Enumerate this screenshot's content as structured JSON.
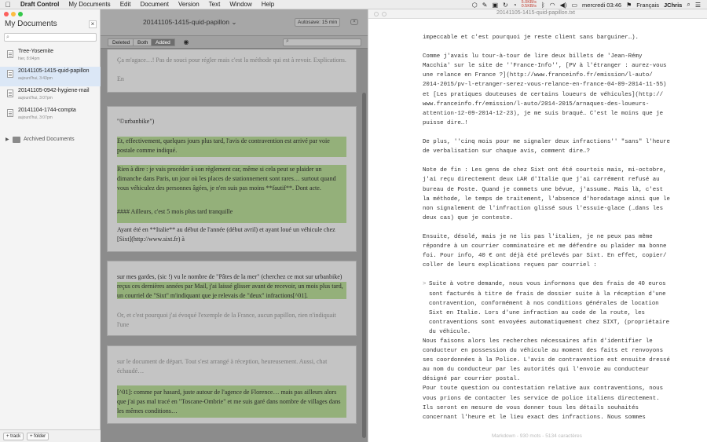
{
  "menubar": {
    "app_name": "Draft Control",
    "items": [
      "My Documents",
      "Edit",
      "Document",
      "Version",
      "Text",
      "Window",
      "Help"
    ],
    "speed_up": "5.0KB/s",
    "speed_down": "0.5KB/s",
    "clock": "mercredi 03:46",
    "language": "Français",
    "user": "JChris"
  },
  "sidebar": {
    "title": "My Documents",
    "close_label": "×",
    "documents": [
      {
        "name": "Tree-Yosemite",
        "date": "hier, 8:04pm"
      },
      {
        "name": "20141105-1415-quid-papillon",
        "date": "aujourd'hui, 3:43pm"
      },
      {
        "name": "20141105-0942-hygiene-mail",
        "date": "aujourd'hui, 3:07pm"
      },
      {
        "name": "20141104-1744-compta",
        "date": "aujourd'hui, 3:07pm"
      }
    ],
    "archived_label": "Archived Documents",
    "add_track_label": "+ track",
    "add_folder_label": "+ folder"
  },
  "document_pane": {
    "title": "20141105-1415-quid-papillon ⌄",
    "autosave": "Autosave: 15 min",
    "filters": {
      "deleted": "Deleted",
      "both": "Both",
      "added": "Added"
    },
    "cards": [
      {
        "lines": [
          "Ça m'agace…! Pas de souci pour régler mais c'est la méthode qui est à revoir. Explications.",
          "En"
        ]
      },
      {
        "quote": "\"©urbanbike\")",
        "p1": "Et, effectivement, quelques jours plus tard, l'avis de contravention est arrivé par voie postale comme indiqué.",
        "p2": "Rien à dire : je vais procéder à son règlement car, même si cela peut se plaider un dimanche dans Paris, un jour où les places de stationnement sont rares… surtout quand vous véhiculez des personnes âgées, je n'en suis pas moins **fautif**. Dont acte.",
        "heading": "#### Ailleurs, c'est 5 mois plus tard tranquille",
        "p3": "Ayant été en **Italie** au début de l'année (début avril) et ayant loué un véhicule chez [Sixt](http://www.sixt.fr) à"
      },
      {
        "p1": "sur mes gardes, (sic !) vu le nombre de \"Pâtes de la mer\" (cherchez ce mot sur urbanbike) reçus ces dernières années par Mail, j'ai laissé glisser avant de recevoir, un mois plus tard, un courriel de \"Sixt\" m'indiquant que je relevais de \"deux\" infractions[^01].",
        "p2": "Or, et c'est pourquoi j'ai évoqué l'exemple de la France, aucun papillon, rien n'indiquait l'une"
      },
      {
        "p1": "sur le document de départ. Tout s'est arrangé à réception, heureusement. Aussi, chat échaudé…",
        "p2": "[^01]: comme par hasard, juste autour de l'agence de Florence… mais pas ailleurs alors que j'ai pas mal tracé en \"Toscane-Ombrie\" et me suis garé dans nombre de villages dans les mêmes conditions…"
      }
    ]
  },
  "editor": {
    "title": "20141105-1415-quid-papillon.txt",
    "footer": "Markdown - 930 mots - 5134 caractères",
    "lines": [
      {
        "t": "impeccable et c'est pourquoi je reste client sans barguiner…)."
      },
      {
        "gap": true
      },
      {
        "t": "Comme j'avais lu tour-à-tour de lire deux billets de 'Jean-Rémy"
      },
      {
        "t": "Macchia' sur le site de ''France-Info'', [PV à l'étranger : aurez-vous"
      },
      {
        "t": "une relance en France ?](http://www.franceinfo.fr/emission/l-auto/"
      },
      {
        "t": "2014-2015/pv-l-etranger-serez-vous-relance-en-france-04-09-2014-11-55)"
      },
      {
        "t": "et [Les pratiques douteuses de certains loueurs de véhicules](http://"
      },
      {
        "t": "www.franceinfo.fr/emission/l-auto/2014-2015/arnaques-des-loueurs-"
      },
      {
        "t": "attention-12-09-2014-12-23), je me suis braqué… C'est le moins que je"
      },
      {
        "t": "puisse dire…!"
      },
      {
        "gap": true
      },
      {
        "t": "De plus, ''cinq mois pour me signaler deux infractions'' \"sans\" l'heure"
      },
      {
        "t": "de verbalisation sur chaque avis, comment dire…?"
      },
      {
        "gap": true
      },
      {
        "t": "Note de fin : Les gens de chez Sixt ont été courtois mais, mi-octobre,"
      },
      {
        "t": "j'ai reçu directement deux LAR d'Italie que j'ai carrément refusé au"
      },
      {
        "t": "bureau de Poste. Quand je commets une bévue, j'assume. Mais là, c'est"
      },
      {
        "t": "la méthode, le temps de traitement, l'absence d'horodatage ainsi que le"
      },
      {
        "t": "non signalement de l'infraction glissé sous l'essuie-glace (…dans les"
      },
      {
        "t": "deux cas) que je conteste."
      },
      {
        "gap": true
      },
      {
        "t": "Ensuite, désolé, mais je ne lis pas l'italien, je ne peux pas même"
      },
      {
        "t": "répondre à un courrier comminatoire et me défendre ou plaider ma bonne"
      },
      {
        "t": "foi. Pour info, 40 € ont déjà été prélevés par Sixt. En effet, copier/"
      },
      {
        "t": "coller de leurs explications reçues par courriel :"
      },
      {
        "gap": true
      },
      {
        "t": "Suite à votre demande, nous vous informons que des frais de 40 euros",
        "bq": true
      },
      {
        "t": "sont facturés à titre de frais de dossier suite à la réception d'une",
        "bq": true
      },
      {
        "t": "contravention, conformément à nos conditions générales de location",
        "bq": true
      },
      {
        "t": "Sixt en Italie. Lors d'une infraction au code de la route, les",
        "bq": true
      },
      {
        "t": "contraventions sont envoyées automatiquement chez SIXT, (propriétaire",
        "bq": true
      },
      {
        "t": "du véhicule.",
        "bq": true
      },
      {
        "t": "Nous faisons alors les recherches nécessaires afin d'identifier le"
      },
      {
        "t": "conducteur en possession du véhicule au moment des faits et renvoyons"
      },
      {
        "t": "ses coordonnées à la Police. L'avis de contravention est ensuite dressé"
      },
      {
        "t": "au nom du conducteur par les autorités qui l'envoie au conducteur"
      },
      {
        "t": "désigné par courrier postal."
      },
      {
        "t": "Pour toute question ou contestation relative aux contraventions, nous"
      },
      {
        "t": "vous prions de contacter les service de police italiens directement."
      },
      {
        "t": "Ils seront en mesure de vous donner tous les détails souhaités"
      },
      {
        "t": "concernant l'heure et le lieu exact des infractions. Nous sommes"
      }
    ]
  }
}
